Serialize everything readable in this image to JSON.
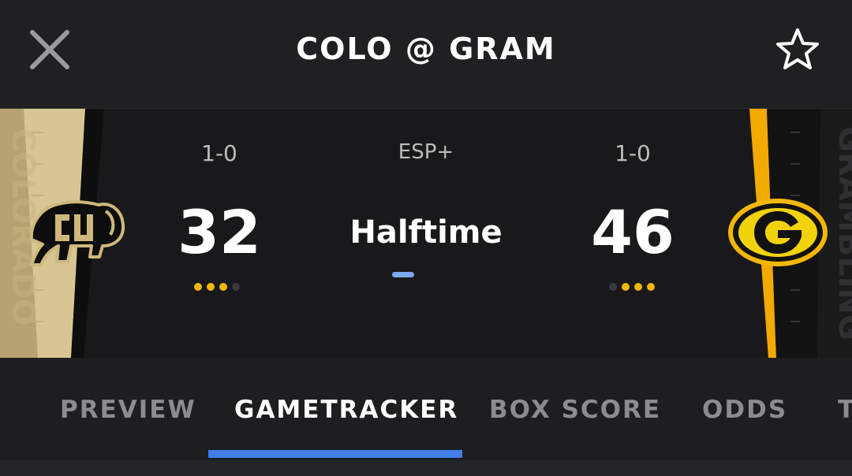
{
  "header": {
    "title": "COLO @ GRAM",
    "close_icon": "close-icon",
    "favorite_icon": "star-outline-icon"
  },
  "game": {
    "network": "ESP+",
    "status": "Halftime",
    "home": {
      "abbr": "COLO",
      "record": "1-0",
      "score": "32",
      "timeouts_remaining": 3,
      "timeouts_total": 4,
      "band_text": "COLORADO",
      "band_color": "#cfb87c",
      "logo_icon": "buffalo-logo-icon"
    },
    "away": {
      "abbr": "GRAM",
      "record": "1-0",
      "score": "46",
      "timeouts_remaining": 3,
      "timeouts_total": 4,
      "band_text": "GRAMBLING",
      "band_color": "#f2a900",
      "logo_icon": "g-logo-icon"
    }
  },
  "tabs": {
    "items": [
      "PREVIEW",
      "GAMETRACKER",
      "BOX SCORE",
      "ODDS",
      "T"
    ],
    "active_index": 1
  },
  "colors": {
    "background": "#1e1f21",
    "accent_blue": "#3f7fe6",
    "timeout_active": "#f2b705",
    "timeout_used": "#3a3a3c"
  }
}
